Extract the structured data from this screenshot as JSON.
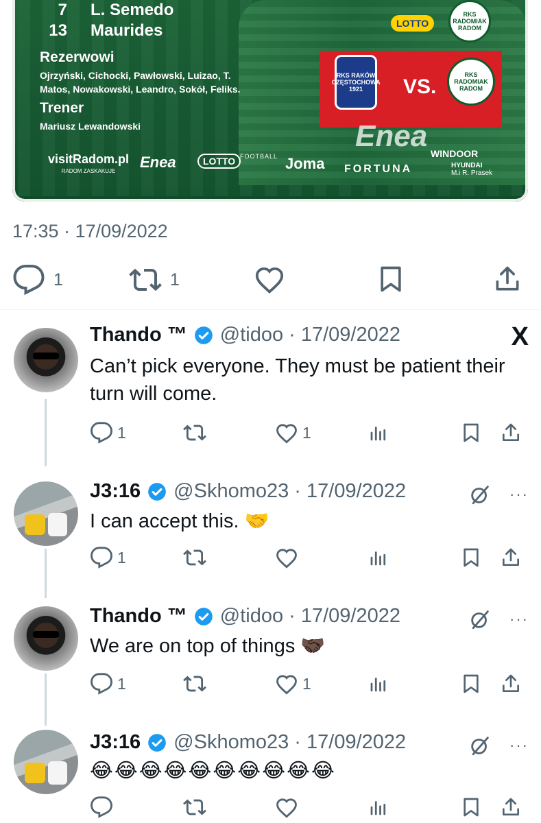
{
  "media": {
    "lineup_rows": [
      {
        "num": "7",
        "name": "L. Semedo"
      },
      {
        "num": "13",
        "name": "Maurides"
      }
    ],
    "reserves_heading": "Rezerwowi",
    "reserves_list": "Ojrzyński, Cichocki, Pawłowski, Luizao, T. Matos, Nowakowski, Leandro, Sokół, Feliks.",
    "coach_heading": "Trener",
    "coach_name": "Mariusz Lewandowski",
    "vs_label": "VS.",
    "rakow_badge": "RKS RAKÓW CZĘSTOCHOWA 1921",
    "radomiak_badge": "RKS RADOMIAK RADOM",
    "radomiak_badge_top": "RKS RADOMIAK RADOM",
    "lotto_top": "LOTTO",
    "enea_big": "Enea",
    "sponsors": {
      "visit": "visitRadom.pl",
      "visit_sub": "RADOM ZASKAKUJE",
      "enea": "Enea",
      "lotto": "LOTTO",
      "football": "FOOTBALL",
      "joma": "Joma",
      "windoor": "WINDOOR",
      "fortuna": "FORTUNA",
      "hyundai": "HYUNDAI",
      "hyundai_sub": "M.i R. Prasek"
    }
  },
  "main_tweet": {
    "timestamp": "17:35 · 17/09/2022",
    "reply_count": "1",
    "retweet_count": "1"
  },
  "replies": [
    {
      "name": "Thando ™",
      "handle": "@tidoo · 17/09/2022",
      "text": "Can’t pick everyone. They must be patient their turn will come.",
      "reply_count": "1",
      "like_count": "1",
      "corner": "x-logo"
    },
    {
      "name": "J3:16",
      "handle": "@Skhomo23 · 17/09/2022",
      "text": "I can accept this. 🤝",
      "reply_count": "1",
      "like_count": "",
      "corner": "grok-and-more"
    },
    {
      "name": "Thando ™",
      "handle": "@tidoo · 17/09/2022",
      "text": "We are on top of things 🤝🏿",
      "reply_count": "1",
      "like_count": "1",
      "corner": "grok-and-more"
    },
    {
      "name": "J3:16",
      "handle": "@Skhomo23 · 17/09/2022",
      "text": "😂😂😂😂😂😂😂😂😂😂",
      "reply_count": "",
      "like_count": "",
      "corner": "grok-and-more"
    }
  ],
  "labels": {
    "x_logo": "X",
    "more": "···"
  },
  "colors": {
    "secondary_text": "#536471",
    "verified_blue": "#1d9bf0",
    "pitch_green": "#1d6438",
    "accent_red": "#d81f26"
  }
}
